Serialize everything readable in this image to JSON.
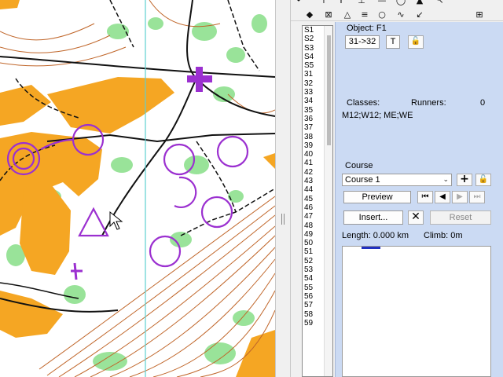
{
  "map": {
    "colors": {
      "open_land": "#f5a623",
      "forest_green": "#7ed87e",
      "course_purple": "#9b30d0",
      "contour_brown": "#c0662a",
      "track_black": "#111111"
    }
  },
  "toolbar": {
    "tools": [
      {
        "icon": "tool-dot-icon",
        "glyph": "•"
      },
      {
        "icon": "tool-up-arrow-icon",
        "glyph": "↑"
      },
      {
        "icon": "tool-fork-icon",
        "glyph": "Y"
      },
      {
        "icon": "tool-measure-icon",
        "glyph": "⊥"
      },
      {
        "icon": "tool-line-icon",
        "glyph": "—"
      },
      {
        "icon": "tool-circle-icon",
        "glyph": "◯"
      },
      {
        "icon": "tool-mountain-icon",
        "glyph": "▲"
      },
      {
        "icon": "tool-pointer-icon",
        "glyph": "↖"
      },
      {
        "icon": "tool-diamond-icon",
        "glyph": "◆"
      },
      {
        "icon": "tool-crosshatch-icon",
        "glyph": "⊠"
      },
      {
        "icon": "tool-triangle-icon",
        "glyph": "△"
      },
      {
        "icon": "tool-text-lines-icon",
        "glyph": "≡"
      },
      {
        "icon": "tool-ring-icon",
        "glyph": "○"
      },
      {
        "icon": "tool-curve-icon",
        "glyph": "∿"
      },
      {
        "icon": "tool-arrow-icon",
        "glyph": "↙"
      },
      {
        "icon": "tool-grid-icon",
        "glyph": "⊞"
      }
    ]
  },
  "controls": {
    "items": [
      "S1",
      "S2",
      "S3",
      "S4",
      "S5",
      "31",
      "32",
      "33",
      "34",
      "35",
      "36",
      "37",
      "38",
      "39",
      "40",
      "41",
      "42",
      "43",
      "44",
      "45",
      "46",
      "47",
      "48",
      "49",
      "50",
      "51",
      "52",
      "53",
      "54",
      "55",
      "56",
      "57",
      "58",
      "59"
    ]
  },
  "panel": {
    "object_label": "Object: F1",
    "object_value": "31->32",
    "t_button": "T",
    "lock_icon": "lock-icon",
    "classes_label": "Classes:",
    "runners_label": "Runners:",
    "runners_value": "0",
    "classes_value": "M12;W12; ME;WE",
    "course_label": "Course",
    "course_selected": "Course 1",
    "add_icon": "plus-icon",
    "preview_label": "Preview",
    "insert_label": "Insert...",
    "reset_label": "Reset",
    "length_label": "Length: 0.000 km",
    "climb_label": "Climb: 0m"
  }
}
